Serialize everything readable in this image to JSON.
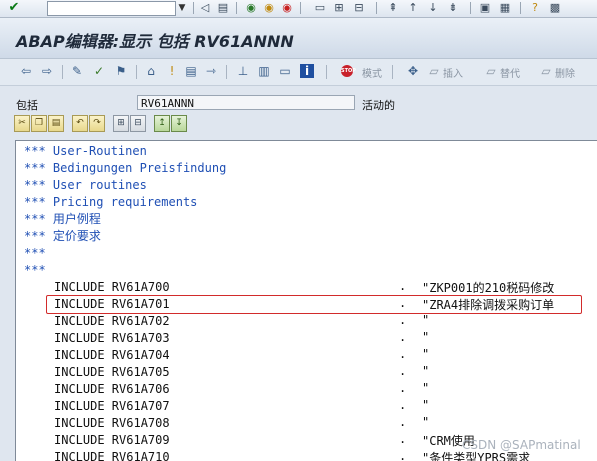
{
  "window": {
    "title": "ABAP编辑器:显示 包括 RV61ANNN"
  },
  "system_toolbar": {
    "icons": [
      "enter-icon",
      "back-icon",
      "save-icon",
      "nav-back-icon",
      "exit-icon",
      "cancel-icon",
      "print-icon",
      "find-icon",
      "find-next-icon",
      "first-page-icon",
      "prev-page-icon",
      "next-page-icon",
      "last-page-icon",
      "layout-icon",
      "new-session-icon",
      "help-icon",
      "settings-icon"
    ]
  },
  "app_toolbar": {
    "mode_label": "模式",
    "insert_label": "插入",
    "replace_label": "替代",
    "delete_label": "删除"
  },
  "package": {
    "label": "包括",
    "value": "RV61ANNN",
    "status": "活动的"
  },
  "editor": {
    "comments": [
      "*** User-Routinen",
      "*** Bedingungen Preisfindung",
      "*** User routines",
      "*** Pricing requirements",
      "*** 用户例程",
      "*** 定价要求",
      "***",
      "***"
    ],
    "includes": [
      {
        "code": "INCLUDE RV61A700",
        "dot": ".",
        "note": "\"ZKP001的210税码修改"
      },
      {
        "code": "INCLUDE RV61A701",
        "dot": ".",
        "note": "\"ZRA4排除调拨采购订单"
      },
      {
        "code": "INCLUDE RV61A702",
        "dot": ".",
        "note": "\""
      },
      {
        "code": "INCLUDE RV61A703",
        "dot": ".",
        "note": "\""
      },
      {
        "code": "INCLUDE RV61A704",
        "dot": ".",
        "note": "\""
      },
      {
        "code": "INCLUDE RV61A705",
        "dot": ".",
        "note": "\""
      },
      {
        "code": "INCLUDE RV61A706",
        "dot": ".",
        "note": "\""
      },
      {
        "code": "INCLUDE RV61A707",
        "dot": ".",
        "note": "\""
      },
      {
        "code": "INCLUDE RV61A708",
        "dot": ".",
        "note": "\""
      },
      {
        "code": "INCLUDE RV61A709",
        "dot": ".",
        "note": "\"CRM使用"
      },
      {
        "code": "INCLUDE RV61A710",
        "dot": ".",
        "note": "\"条件类型YPRS需求"
      }
    ],
    "highlight_color": "#d22b2b"
  },
  "watermark": "CSDN @SAPmatinal"
}
